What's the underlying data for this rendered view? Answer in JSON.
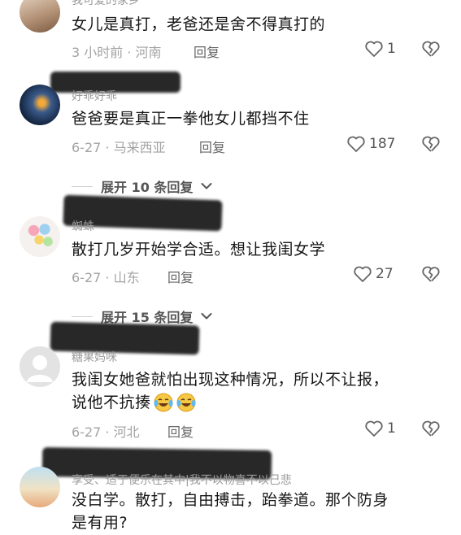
{
  "comments": [
    {
      "username": "我可爱的家乡",
      "text_lines": [
        "女儿是真打，老爸还是舍不得真打的"
      ],
      "meta": "3 小时前 · 河南",
      "reply_label": "回复",
      "likes": "1"
    },
    {
      "username": "好乖好乖",
      "text_lines": [
        "爸爸要是真正一拳他女儿都挡不住"
      ],
      "meta": "6-27 · 马来西亚",
      "reply_label": "回复",
      "likes": "187",
      "expand_label": "展开 10 条回复"
    },
    {
      "username": "蜘蛛",
      "text_lines": [
        "散打几岁开始学合适。想让我闺女学"
      ],
      "meta": "6-27 · 山东",
      "reply_label": "回复",
      "likes": "27",
      "expand_label": "展开 15 条回复"
    },
    {
      "username": "糖果妈咪",
      "text_lines": [
        "我闺女她爸就怕出现这种情况，所以不让报，",
        "说他不抗揍"
      ],
      "meta": "6-27 · 河北",
      "reply_label": "回复",
      "likes": "1"
    },
    {
      "username": "享受、适于便乐在其中|我不以物喜不以己悲",
      "text_lines": [
        "没白学。散打，自由搏击，跆拳道。那个防身",
        "是有用?"
      ]
    }
  ],
  "colors": {
    "text": "#161616",
    "meta": "#a3a3a3",
    "redaction": "#161616"
  },
  "icons": [
    "heart-outline-icon",
    "broken-heart-icon",
    "chevron-down-icon",
    "laughing-crying-emoji"
  ]
}
